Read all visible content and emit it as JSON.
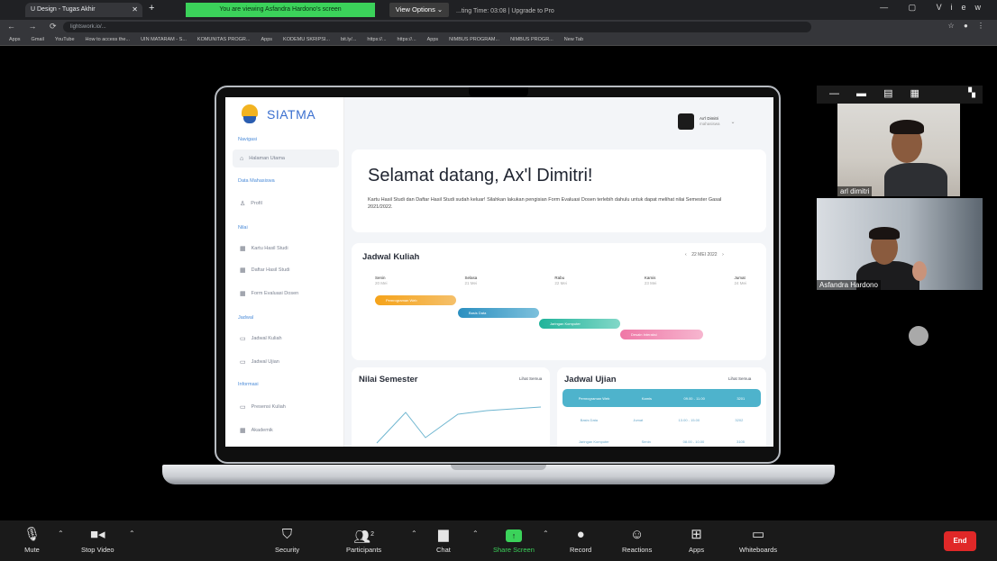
{
  "browser": {
    "tab_title": "U Design - Tugas Akhir",
    "share_banner": "You are viewing Asfandra Hardono's screen",
    "view_options": "View Options",
    "upgrade_text": "...ting Time: 03:08 | Upgrade to Pro",
    "url": "lightswork.io/...",
    "window_view": "View",
    "bookmarks": [
      "Apps",
      "Gmail",
      "YouTube",
      "How to access the...",
      "UIN MATARAM - S...",
      "KOMUNITAS PROGR...",
      "Apps",
      "KODEMU SKRIPSI...",
      "bit.ly/...",
      "https://...",
      "https://...",
      "Apps",
      "NIMBUS PROGRAM...",
      "NIMBUS PROGR...",
      "New Tab"
    ]
  },
  "app": {
    "brand": "SIATMA",
    "sidebar": {
      "sections": {
        "navigasi": "Navigasi",
        "data_mahasiswa": "Data Mahasiswa",
        "nilai": "Nilai",
        "jadwal": "Jadwal",
        "informasi": "Informasi"
      },
      "items": {
        "halaman_utama": "Halaman Utama",
        "profil": "Profil",
        "khs": "Kartu Hasil Studi",
        "dhs": "Daftar Hasil Studi",
        "form_evaluasi": "Form Evaluasi Dosen",
        "jadwal_kuliah": "Jadwal Kuliah",
        "jadwal_ujian": "Jadwal Ujian",
        "presensi": "Presensi Kuliah",
        "akademik": "Akademik"
      }
    },
    "user": {
      "name": "Ax'l Dimitri",
      "sub": "mahasiswa"
    },
    "welcome": {
      "title": "Selamat datang, Ax'l Dimitri!",
      "text": "Kartu Hasil Studi dan Daftar Hasil Studi sudah keluar! Silahkan lakukan pengisian Form Evaluasi Dosen terlebih dahulu untuk dapat melihat nilai Semester Gasal 2021/2022."
    },
    "schedule": {
      "title": "Jadwal Kuliah",
      "date": "22 MEI 2022",
      "days": [
        {
          "name": "Senin",
          "date": "20 Mei"
        },
        {
          "name": "Selasa",
          "date": "21 Mei"
        },
        {
          "name": "Rabu",
          "date": "22 Mei"
        },
        {
          "name": "Kamis",
          "date": "23 Mei"
        },
        {
          "name": "Jumat",
          "date": "24 Mei"
        }
      ],
      "bars": [
        "Pemrograman Web",
        "Basis Data",
        "Jaringan Komputer",
        "Desain Interaksi"
      ]
    },
    "nilai": {
      "title": "Nilai Semester",
      "link": "Lihat Semua"
    },
    "ujian": {
      "title": "Jadwal Ujian",
      "link": "Lihat Semua",
      "rows": [
        [
          "Pemrograman Web",
          "Kamis",
          "09.00 - 11.00",
          "3201"
        ],
        [
          "Basis Data",
          "Jumat",
          "13.00 - 15.00",
          "3202"
        ],
        [
          "Jaringan Komputer",
          "Senin",
          "08.00 - 10.00",
          "3105"
        ]
      ]
    }
  },
  "participants": [
    {
      "name": "arl dimitri"
    },
    {
      "name": "Asfandra Hardono"
    }
  ],
  "zoom_toolbar": {
    "mute": "Mute",
    "stop_video": "Stop Video",
    "security": "Security",
    "participants": "Participants",
    "participants_count": "2",
    "chat": "Chat",
    "share_screen": "Share Screen",
    "record": "Record",
    "reactions": "Reactions",
    "apps": "Apps",
    "whiteboards": "Whiteboards",
    "end": "End"
  }
}
